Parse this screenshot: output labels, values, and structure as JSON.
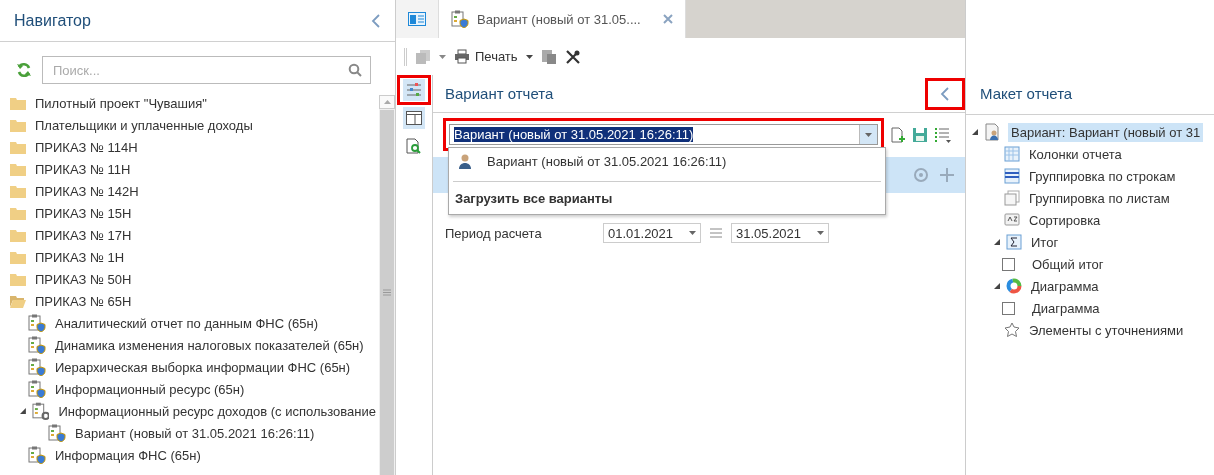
{
  "navigator": {
    "title": "Навигатор",
    "search": {
      "placeholder": "Поиск..."
    },
    "items": [
      {
        "kind": "folder",
        "label": "Пилотный проект \"Чувашия\"",
        "expanded": false
      },
      {
        "kind": "folder",
        "label": "Плательщики и уплаченные доходы",
        "expanded": false
      },
      {
        "kind": "folder",
        "label": "ПРИКАЗ № 114Н",
        "expanded": false
      },
      {
        "kind": "folder",
        "label": "ПРИКАЗ № 11Н",
        "expanded": false
      },
      {
        "kind": "folder",
        "label": "ПРИКАЗ № 142Н",
        "expanded": false
      },
      {
        "kind": "folder",
        "label": "ПРИКАЗ № 15Н",
        "expanded": false
      },
      {
        "kind": "folder",
        "label": "ПРИКАЗ № 17Н",
        "expanded": false
      },
      {
        "kind": "folder",
        "label": "ПРИКАЗ № 1Н",
        "expanded": false
      },
      {
        "kind": "folder",
        "label": "ПРИКАЗ № 50Н",
        "expanded": false
      },
      {
        "kind": "folder",
        "label": "ПРИКАЗ № 65Н",
        "expanded": true,
        "children": [
          {
            "kind": "report",
            "label": "Аналитический отчет по данным ФНС (65н)"
          },
          {
            "kind": "report",
            "label": "Динамика изменения налоговых показателей (65н)"
          },
          {
            "kind": "report",
            "label": "Иерархическая выборка информации ФНС (65н)"
          },
          {
            "kind": "report",
            "label": "Информационный ресурс (65н)"
          },
          {
            "kind": "settings",
            "label": "Информационный ресурс доходов (с использование",
            "expanded": true,
            "children": [
              {
                "kind": "report",
                "label": "Вариант (новый от 31.05.2021 16:26:11)"
              }
            ]
          },
          {
            "kind": "report",
            "label": "Информация ФНС (65н)"
          }
        ]
      }
    ]
  },
  "tabs": [
    {
      "kind": "home",
      "selected": false
    },
    {
      "kind": "document",
      "label": "Вариант (новый от 31.05....",
      "selected": true
    }
  ],
  "toolbar": {
    "print": "Печать"
  },
  "variant_panel": {
    "title": "Вариант отчета",
    "strip_highlighted": true,
    "collapse_highlighted": true,
    "combo": {
      "value": "Вариант (новый от 31.05.2021 16:26:11)",
      "open": true,
      "highlighted": true
    },
    "dropdown": {
      "items": [
        {
          "label": "Вариант (новый от 31.05.2021 16:26:11)"
        }
      ],
      "load_all": "Загрузить все варианты"
    },
    "period": {
      "label": "Период расчета",
      "from": "01.01.2021",
      "to": "31.05.2021"
    }
  },
  "layout_panel": {
    "title": "Макет отчета",
    "items": [
      {
        "kind": "variant",
        "label": "Вариант: Вариант (новый от 31",
        "selected": true,
        "expanded": true,
        "children": [
          {
            "kind": "columns",
            "label": "Колонки отчета",
            "selected": false
          },
          {
            "kind": "rows",
            "label": "Группировка по строкам",
            "selected": false
          },
          {
            "kind": "sheets",
            "label": "Группировка по листам",
            "selected": false
          },
          {
            "kind": "sort",
            "label": "Сортировка",
            "selected": false
          },
          {
            "kind": "total",
            "label": "Итог",
            "selected": false,
            "expanded": true,
            "children": [
              {
                "kind": "checkbox",
                "label": "Общий итог",
                "selected": false,
                "checked": false
              }
            ]
          },
          {
            "kind": "chart",
            "label": "Диаграмма",
            "selected": false,
            "expanded": true,
            "children": [
              {
                "kind": "checkbox",
                "label": "Диаграмма",
                "selected": false,
                "checked": false
              }
            ]
          },
          {
            "kind": "refine",
            "label": "Элементы с уточнениями",
            "selected": false
          }
        ]
      }
    ]
  }
}
